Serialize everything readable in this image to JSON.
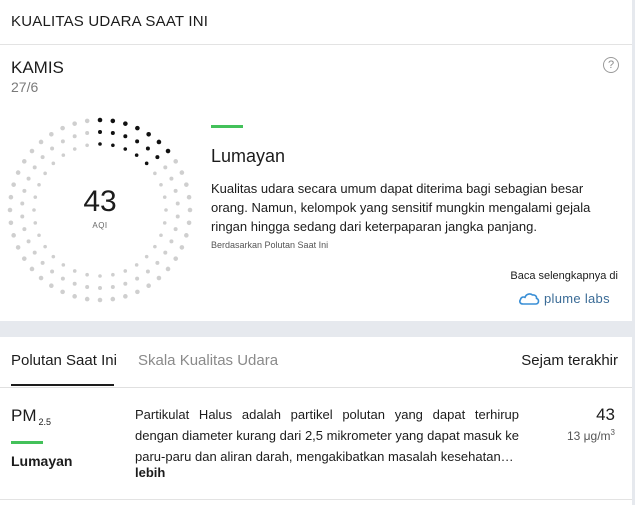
{
  "header": {
    "title": "KUALITAS UDARA SAAT INI"
  },
  "summary": {
    "day": "KAMIS",
    "date": "27/6",
    "help_icon": "?",
    "aqi_value": "43",
    "aqi_label": "AQI",
    "level": "Lumayan",
    "level_color": "#43c15a",
    "description": "Kualitas udara secara umum dapat diterima bagi sebagian besar orang. Namun, kelompok yang sensitif mungkin mengalami gejala ringan hingga sedang dari keterpaparan jangka panjang.",
    "based_on": "Berdasarkan Polutan Saat Ini",
    "read_more": "Baca selengkapnya di",
    "provider": "plume labs",
    "gauge": {
      "value": 43,
      "max": 300,
      "icon": "dotted-radial-gauge"
    }
  },
  "tabs": {
    "current_pollutants": "Polutan Saat Ini",
    "aqi_scale": "Skala Kualitas Udara",
    "recent": "Sejam terakhir"
  },
  "pollutants": [
    {
      "name": "PM",
      "subscript": "2.5",
      "level": "Lumayan",
      "level_color": "#43c15a",
      "description": "Partikulat Halus adalah partikel polutan yang dapat terhirup dengan diameter kurang dari 2,5 mikrometer yang dapat masuk ke paru-paru dan aliran darah, mengakibatkan masalah kesehatan…",
      "more": "lebih",
      "value": "43",
      "unit": "13 μg/m",
      "unit_sup": "3"
    }
  ]
}
